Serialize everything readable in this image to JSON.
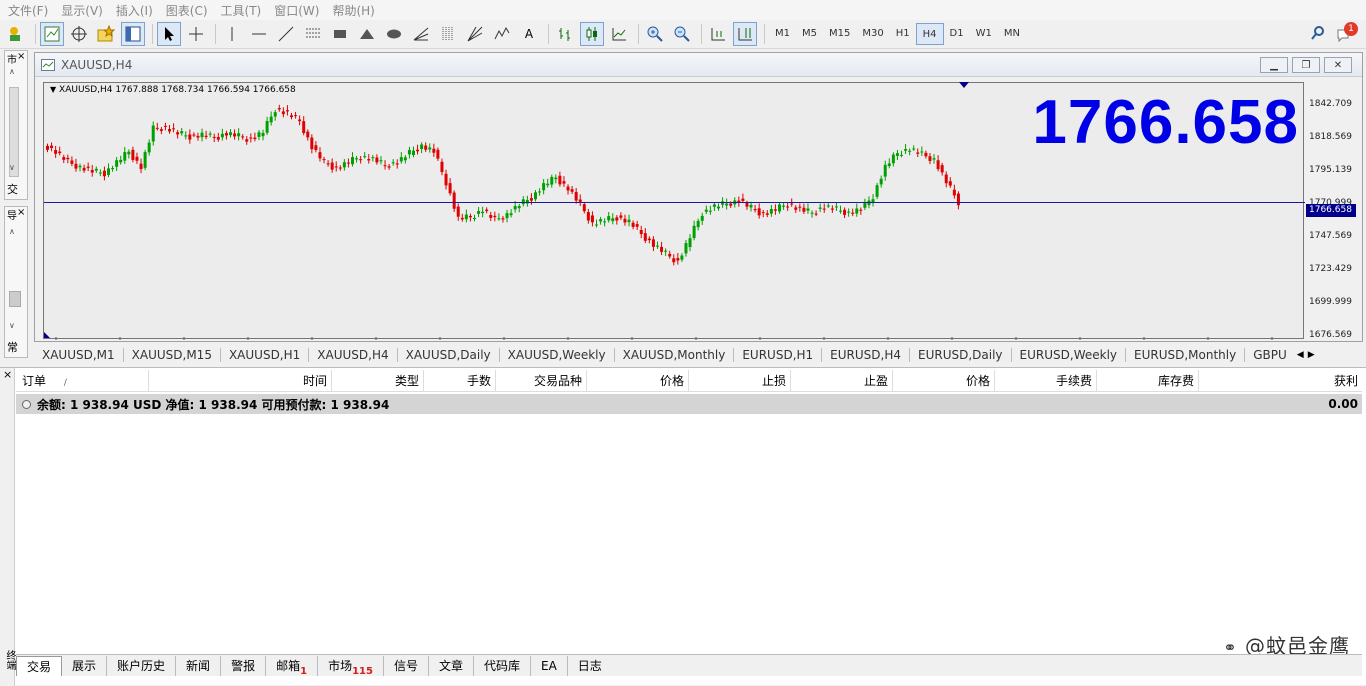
{
  "menu": [
    "文件(F)",
    "显示(V)",
    "插入(I)",
    "图表(C)",
    "工具(T)",
    "窗口(W)",
    "帮助(H)"
  ],
  "toolbar": {
    "timeframes": [
      "M1",
      "M5",
      "M15",
      "M30",
      "H1",
      "H4",
      "D1",
      "W1",
      "MN"
    ],
    "active_timeframe": "H4",
    "notification_count": "1",
    "text_tool_label": "A"
  },
  "left_panels": {
    "top_label": "市",
    "top_tab": "交",
    "bottom_label": "导",
    "bottom_tab": "常"
  },
  "chart_window": {
    "title": "XAUUSD,H4",
    "symbol_info": "XAUUSD,H4  1767.888 1768.734 1766.594 1766.658",
    "big_price": "1766.658",
    "price_tag": "1766.658"
  },
  "chart_data": {
    "type": "candlestick",
    "symbol": "XAUUSD",
    "timeframe": "H4",
    "y_ticks": [
      "1842.709",
      "1818.569",
      "1795.139",
      "1770.999",
      "1747.569",
      "1723.429",
      "1699.999",
      "1676.569"
    ],
    "ylim": [
      1676.569,
      1845
    ],
    "current_price": 1766.658,
    "last_bar": {
      "open": 1767.888,
      "high": 1768.734,
      "low": 1766.594,
      "close": 1766.658
    },
    "bull_color": "#00a000",
    "bear_color": "#e00000",
    "close_path": [
      1805,
      1800,
      1793,
      1790,
      1787,
      1786,
      1793,
      1800,
      1790,
      1815,
      1816,
      1812,
      1810,
      1811,
      1809,
      1812,
      1810,
      1808,
      1813,
      1828,
      1825,
      1820,
      1803,
      1793,
      1789,
      1793,
      1797,
      1795,
      1791,
      1793,
      1799,
      1804,
      1800,
      1780,
      1756,
      1757,
      1762,
      1755,
      1759,
      1765,
      1770,
      1778,
      1783,
      1776,
      1765,
      1753,
      1755,
      1757,
      1754,
      1746,
      1739,
      1733,
      1728,
      1744,
      1760,
      1764,
      1766,
      1768,
      1763,
      1759,
      1762,
      1766,
      1762,
      1760,
      1764,
      1762,
      1760,
      1762,
      1771,
      1790,
      1799,
      1802,
      1798,
      1795,
      1780,
      1767
    ]
  },
  "symbol_tabs": [
    "XAUUSD,M1",
    "XAUUSD,M15",
    "XAUUSD,H1",
    "XAUUSD,H4",
    "XAUUSD,Daily",
    "XAUUSD,Weekly",
    "XAUUSD,Monthly",
    "EURUSD,H1",
    "EURUSD,H4",
    "EURUSD,Daily",
    "EURUSD,Weekly",
    "EURUSD,Monthly",
    "GBPU"
  ],
  "terminal": {
    "side_label": "终端",
    "columns": [
      "订单",
      "时间",
      "类型",
      "手数",
      "交易品种",
      "价格",
      "止损",
      "止盈",
      "价格",
      "手续费",
      "库存费",
      "获利"
    ],
    "sort_marker": "/",
    "balance_text": "余额: 1 938.94 USD  净值: 1 938.94  可用预付款: 1 938.94",
    "profit_total": "0.00",
    "tabs": [
      {
        "label": "交易",
        "badge": ""
      },
      {
        "label": "展示",
        "badge": ""
      },
      {
        "label": "账户历史",
        "badge": ""
      },
      {
        "label": "新闻",
        "badge": ""
      },
      {
        "label": "警报",
        "badge": ""
      },
      {
        "label": "邮箱",
        "badge": "1"
      },
      {
        "label": "市场",
        "badge": "115"
      },
      {
        "label": "信号",
        "badge": ""
      },
      {
        "label": "文章",
        "badge": ""
      },
      {
        "label": "代码库",
        "badge": ""
      },
      {
        "label": "EA",
        "badge": ""
      },
      {
        "label": "日志",
        "badge": ""
      }
    ],
    "active_tab": "交易"
  },
  "watermark": "@蚊邑金鹰"
}
